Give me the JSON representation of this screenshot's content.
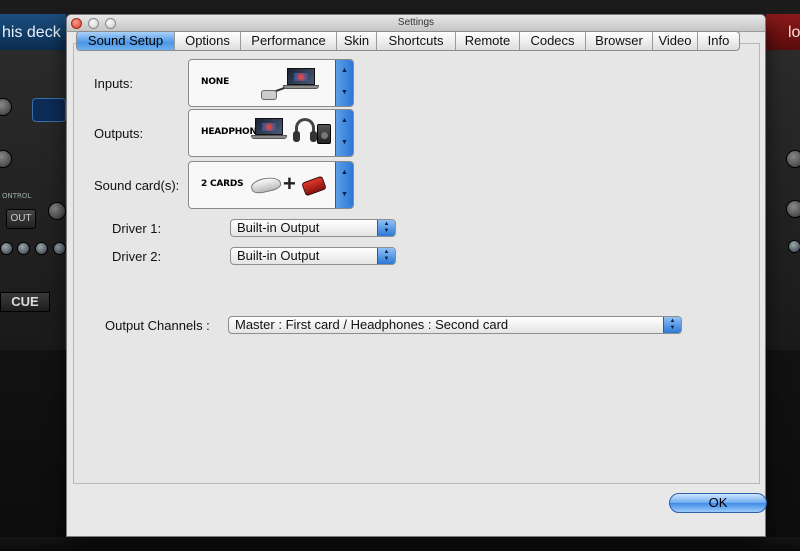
{
  "window": {
    "title": "Settings"
  },
  "tabs": [
    {
      "label": "Sound Setup",
      "active": true
    },
    {
      "label": "Options",
      "active": false
    },
    {
      "label": "Performance",
      "active": false
    },
    {
      "label": "Skin",
      "active": false
    },
    {
      "label": "Shortcuts",
      "active": false
    },
    {
      "label": "Remote",
      "active": false
    },
    {
      "label": "Codecs",
      "active": false
    },
    {
      "label": "Browser",
      "active": false
    },
    {
      "label": "Video",
      "active": false
    },
    {
      "label": "Info",
      "active": false
    }
  ],
  "sound_setup": {
    "inputs": {
      "label": "Inputs:",
      "value": "NONE"
    },
    "outputs": {
      "label": "Outputs:",
      "value": "HEADPHONES"
    },
    "sound_cards": {
      "label": "Sound card(s):",
      "value": "2 CARDS"
    },
    "driver1": {
      "label": "Driver 1:",
      "value": "Built-in Output"
    },
    "driver2": {
      "label": "Driver 2:",
      "value": "Built-in Output"
    },
    "output_channels": {
      "label": "Output Channels :",
      "value": "Master : First card / Headphones : Second card"
    }
  },
  "buttons": {
    "ok": "OK"
  },
  "background": {
    "left_deck_title": "his deck",
    "right_deck_title": "lo",
    "out_button": "OUT",
    "cue_button": "CUE",
    "control_label": "ONTROL"
  },
  "colors": {
    "accent_blue": "#4c97e6",
    "window_bg": "#e8e8e8",
    "left_deck": "#1b4e7e",
    "right_deck": "#8b1a1a"
  }
}
